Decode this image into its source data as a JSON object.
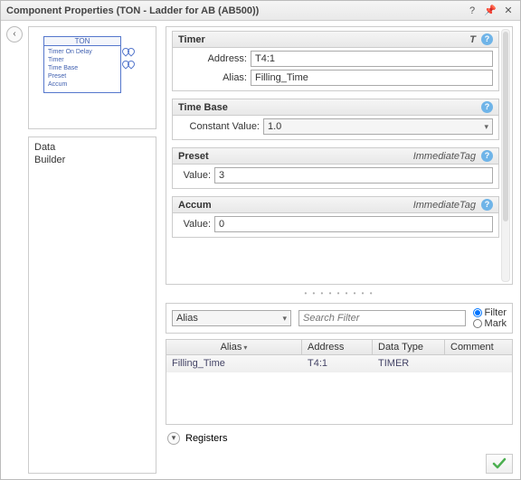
{
  "title": "Component Properties (TON - Ladder for AB (AB500))",
  "thumb": {
    "head": "TON",
    "lines": [
      "Timer On Delay",
      "Timer",
      "Time Base",
      "Preset",
      "Accum"
    ]
  },
  "tree": {
    "data": "Data",
    "builder": "Builder"
  },
  "timer_group": {
    "title": "Timer",
    "letter": "T",
    "address_label": "Address:",
    "address_value": "T4:1",
    "alias_label": "Alias:",
    "alias_value": "Filling_Time"
  },
  "timebase_group": {
    "title": "Time Base",
    "constant_label": "Constant Value:",
    "constant_value": "1.0"
  },
  "preset_group": {
    "title": "Preset",
    "tag": "ImmediateTag",
    "value_label": "Value:",
    "value": "3"
  },
  "accum_group": {
    "title": "Accum",
    "tag": "ImmediateTag",
    "value_label": "Value:",
    "value": "0"
  },
  "filter_bar": {
    "mode": "Alias",
    "search_placeholder": "Search Filter",
    "radio_filter": "Filter",
    "radio_mark": "Mark"
  },
  "grid": {
    "cols": {
      "alias": "Alias",
      "address": "Address",
      "datatype": "Data Type",
      "comment": "Comment"
    },
    "rows": [
      {
        "alias": "Filling_Time",
        "address": "T4:1",
        "datatype": "TIMER",
        "comment": ""
      }
    ]
  },
  "registers_label": "Registers"
}
